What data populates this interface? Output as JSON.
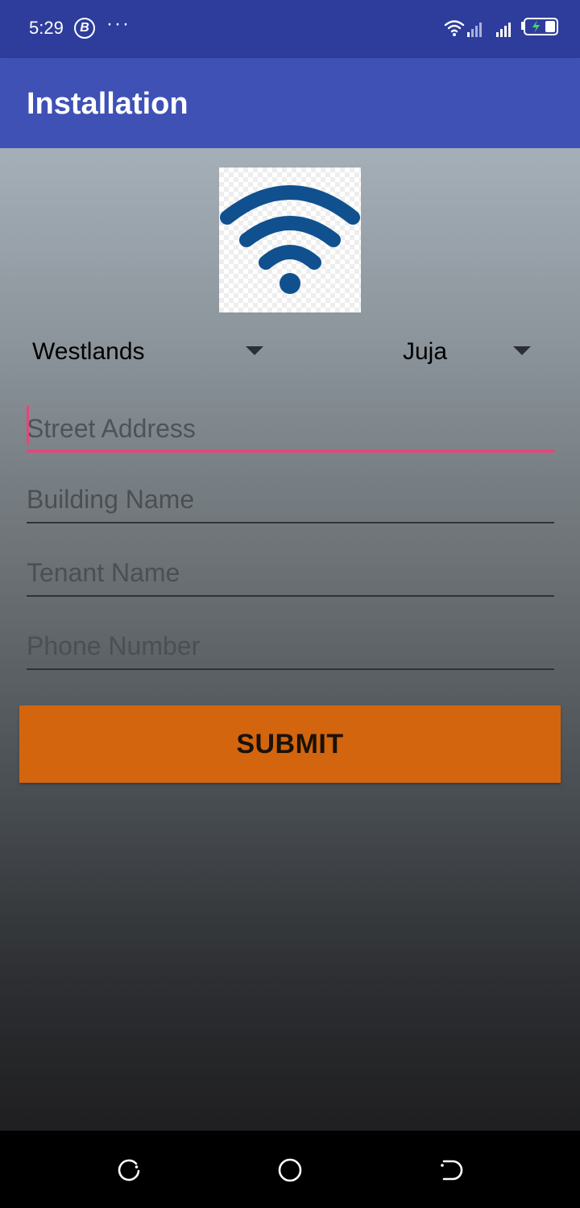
{
  "status_bar": {
    "time": "5:29",
    "badge_letter": "B",
    "overflow": "···",
    "icons": [
      "wifi-icon",
      "signal-icon",
      "signal-icon",
      "battery-charging-icon"
    ]
  },
  "app_bar": {
    "title": "Installation"
  },
  "logo": {
    "icon": "wifi-logo-icon",
    "color": "#10508f"
  },
  "spinners": {
    "region": {
      "selected": "Westlands"
    },
    "area": {
      "selected": "Juja"
    }
  },
  "form": {
    "street": {
      "placeholder": "Street Address",
      "value": ""
    },
    "building": {
      "placeholder": "Building Name",
      "value": ""
    },
    "tenant": {
      "placeholder": "Tenant Name",
      "value": ""
    },
    "phone": {
      "placeholder": "Phone Number",
      "value": ""
    },
    "submit_label": "SUBMIT"
  },
  "colors": {
    "status_bar": "#2e3d9c",
    "app_bar": "#3f51b5",
    "accent": "#e8457a",
    "submit": "#d3650e"
  },
  "nav_bar": {
    "icons": [
      "recents-icon",
      "home-icon",
      "back-icon"
    ]
  }
}
